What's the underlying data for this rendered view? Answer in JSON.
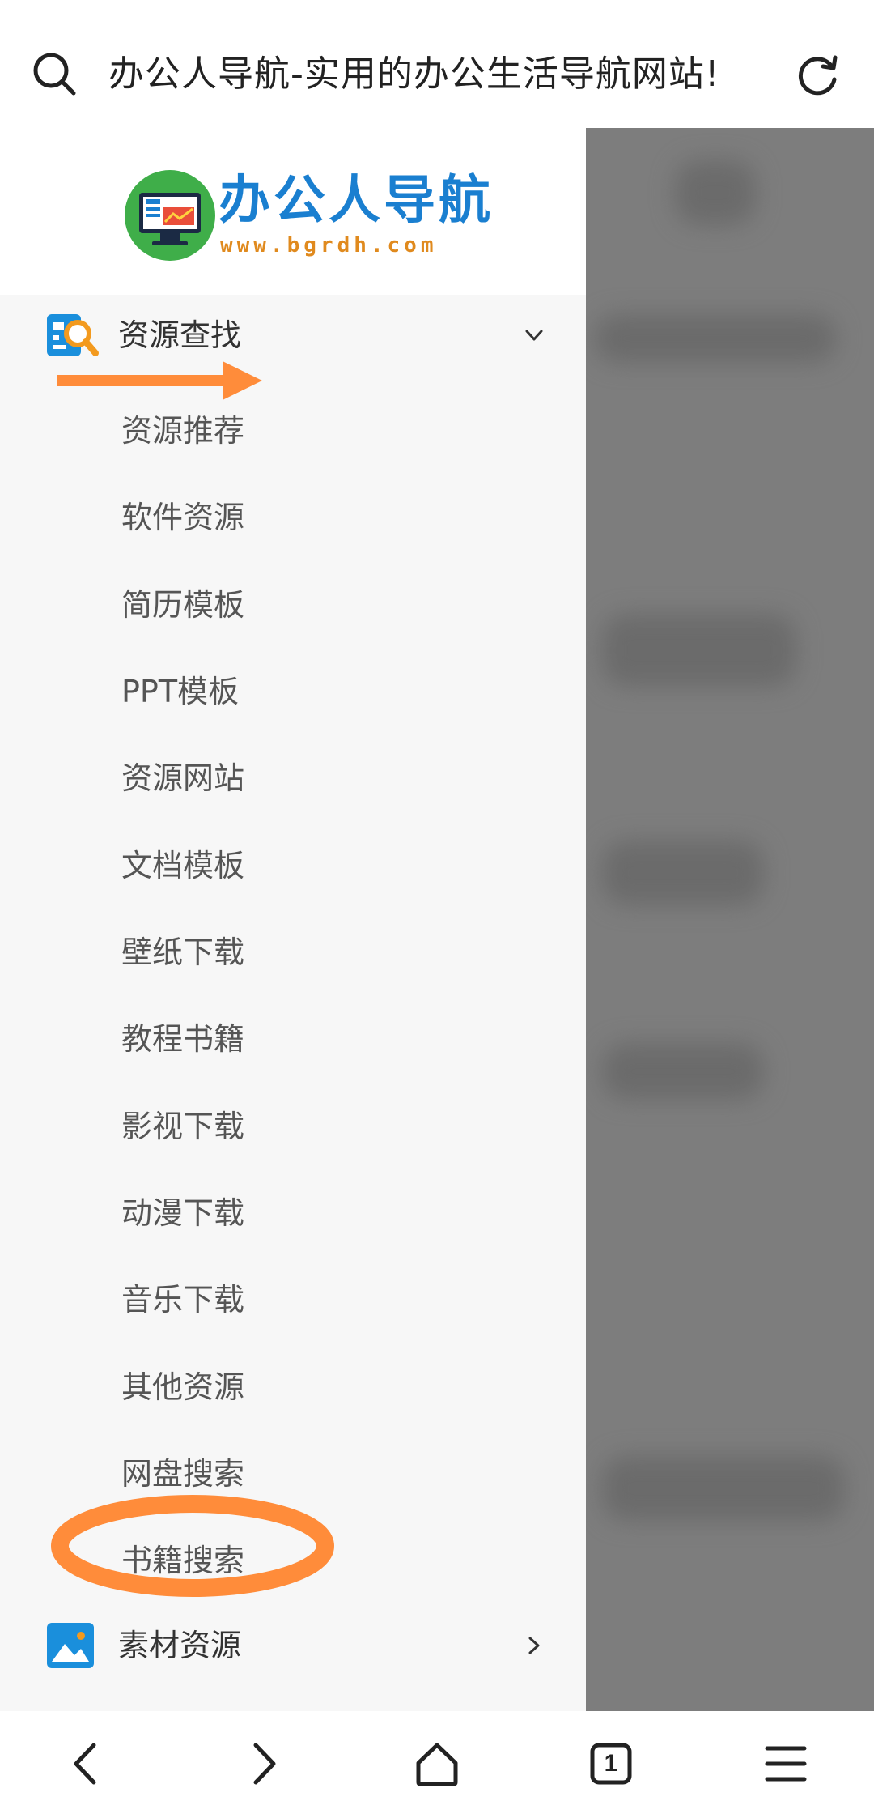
{
  "address_bar": {
    "title": "办公人导航-实用的办公生活导航网站!",
    "search_icon": "search-icon",
    "reload_icon": "reload-icon"
  },
  "logo": {
    "title": "办公人导航",
    "url": "www.bgrdh.com"
  },
  "sidebar": {
    "sections": [
      {
        "label": "资源查找",
        "icon": "resource-search-icon",
        "expanded": true,
        "items": [
          "资源推荐",
          "软件资源",
          "简历模板",
          "PPT模板",
          "资源网站",
          "文档模板",
          "壁纸下载",
          "教程书籍",
          "影视下载",
          "动漫下载",
          "音乐下载",
          "其他资源",
          "网盘搜索",
          "书籍搜索"
        ]
      },
      {
        "label": "素材资源",
        "icon": "image-icon",
        "expanded": false
      }
    ]
  },
  "annotations": {
    "arrow_color": "#ff8c3a",
    "circle_color": "#ff8c3a",
    "circled_item": "书籍搜索"
  },
  "bottom_nav": {
    "tab_count": "1",
    "items": [
      "back-icon",
      "forward-icon",
      "home-icon",
      "tabs-icon",
      "menu-icon"
    ]
  },
  "colors": {
    "drawer_bg": "#f7f7f7",
    "overlay": "#7d7d7d",
    "brand_blue": "#1a7fd0",
    "brand_orange": "#e08a1e"
  }
}
